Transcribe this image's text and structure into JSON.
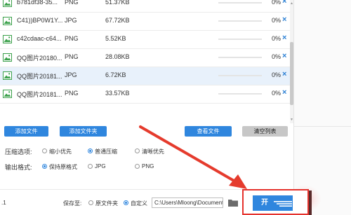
{
  "files": [
    {
      "name": "b781df38-35...",
      "type": "PNG",
      "size": "51.37KB",
      "progress": 0,
      "percent_label": "0%"
    },
    {
      "name": "C41))BP0W1Y...",
      "type": "JPG",
      "size": "67.72KB",
      "progress": 0,
      "percent_label": "0%"
    },
    {
      "name": "c42cdaac-c64...",
      "type": "PNG",
      "size": "5.52KB",
      "progress": 0,
      "percent_label": "0%"
    },
    {
      "name": "QQ图片20180...",
      "type": "PNG",
      "size": "28.08KB",
      "progress": 0,
      "percent_label": "0%"
    },
    {
      "name": "QQ图片20181...",
      "type": "JPG",
      "size": "6.72KB",
      "progress": 0,
      "percent_label": "0%"
    },
    {
      "name": "QQ图片20181...",
      "type": "PNG",
      "size": "33.57KB",
      "progress": 0,
      "percent_label": "0%"
    }
  ],
  "remove_symbol": "×",
  "toolbar": {
    "add_file": "添加文件",
    "add_folder": "添加文件夹",
    "view_files": "查看文件",
    "clear_list": "清空列表"
  },
  "compress_options": {
    "label": "压缩选项:",
    "options": [
      {
        "label": "缩小优先",
        "checked": false
      },
      {
        "label": "普通压缩",
        "checked": true
      },
      {
        "label": "清晰优先",
        "checked": false
      }
    ]
  },
  "output_format": {
    "label": "输出格式:",
    "options": [
      {
        "label": "保持原格式",
        "checked": true
      },
      {
        "label": "JPG",
        "checked": false
      },
      {
        "label": "PNG",
        "checked": false
      }
    ]
  },
  "bottom": {
    "left_text": ".1",
    "save_to_label": "保存至:",
    "save_options": [
      {
        "label": "原文件夹",
        "checked": false
      },
      {
        "label": "自定义",
        "checked": true
      }
    ],
    "path_value": "C:\\Users\\Mloong\\Documents",
    "start_label": "开"
  },
  "colors": {
    "accent": "#2f86de",
    "highlight_border": "#e5322d",
    "arrow": "#e53b2d",
    "selected_row": "#e8f1fb",
    "file_icon": "#3aa04a"
  },
  "icons": {
    "file_icon": "image-file-icon",
    "remove": "close-icon",
    "folder": "folder-icon",
    "arrow": "red-annotation-arrow"
  }
}
